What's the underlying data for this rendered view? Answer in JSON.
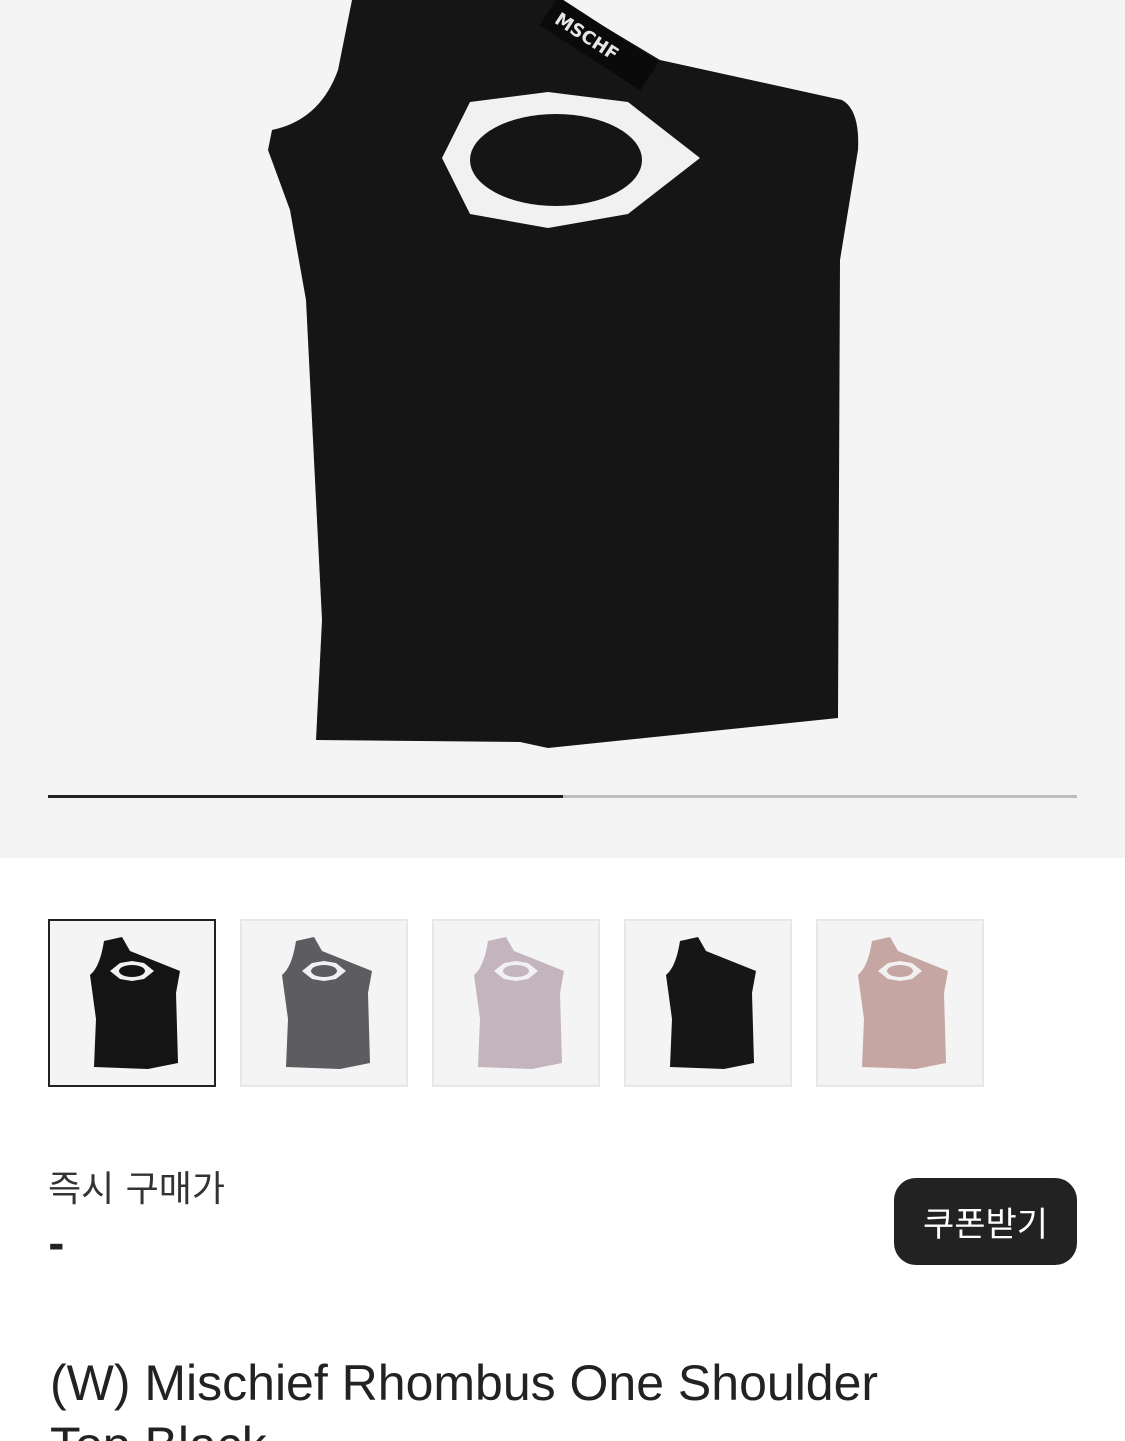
{
  "gallery": {
    "main_image_alt": "Mischief rhombus one shoulder top in black",
    "label_text": "MSCHF",
    "progress": 0.5,
    "thumbnails": [
      {
        "color": "#141414",
        "cutout": true,
        "active": true
      },
      {
        "color": "#5d5c61",
        "cutout": true,
        "active": false
      },
      {
        "color": "#c4b4bd",
        "cutout": true,
        "active": false
      },
      {
        "color": "#161616",
        "cutout": false,
        "active": false
      },
      {
        "color": "#c6a6a2",
        "cutout": true,
        "active": false
      }
    ]
  },
  "price": {
    "label": "즉시 구매가",
    "value": "-"
  },
  "coupon_button": {
    "label": "쿠폰받기"
  },
  "product": {
    "title": "(W) Mischief Rhombus One Shoulder Top Black"
  }
}
